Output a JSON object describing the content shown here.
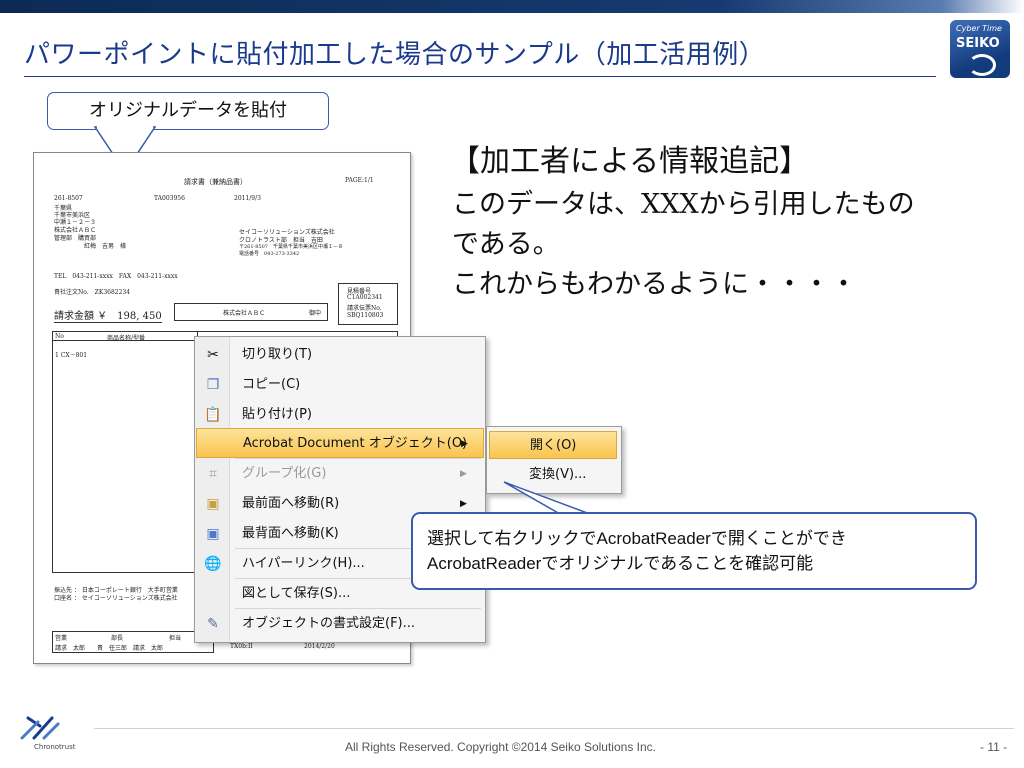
{
  "slide": {
    "title": "パワーポイントに貼付加工した場合のサンプル（加工活用例）",
    "page_number": "- 11 -",
    "copyright": "All Rights Reserved. Copyright ©2014  Seiko Solutions Inc."
  },
  "logo": {
    "line1": "Cyber Time",
    "line2": "SEIKO"
  },
  "brand": {
    "name": "Chronotrust"
  },
  "callout_top": {
    "text": "オリジナルデータを貼付"
  },
  "info": {
    "heading": "【加工者による情報追記】",
    "lines": [
      "このデータは、XXXから引用したもの",
      "である。",
      "これからもわかるように・・・・"
    ]
  },
  "document": {
    "title": "請求書（兼納品書）",
    "page": "PAGE:1/1",
    "number": "TA003956",
    "date": "2011/9/3",
    "postal": "261-8507",
    "addr1": "千葉県",
    "addr2": "千葉市美浜区",
    "addr3": "中瀬１－２－３",
    "customer": "株式会社ＡＢＣ",
    "dept": "管理部　購買部",
    "person": "紅梅　吉男　様",
    "issuer1": "セイコーソリューションズ株式会社",
    "issuer2": "クロノトラスト部　担当　吉田",
    "issuer3": "〒261-8507　千葉県千葉市美浜区中瀬１－８",
    "issuer4": "電話番号　043-273-3342",
    "tel": "TEL　043-211-xxxx　FAX　043-211-xxxx",
    "order": "貴社注文No.　ZK3682234",
    "amount_label": "請求金額 ￥　198, 450",
    "company_box": "株式会社ＡＢＣ",
    "oncho": "御中",
    "estimate_label": "見積番号",
    "estimate_no": "C1A002341",
    "invoice_label": "請求伝票No.",
    "invoice_no": "SBQ110803",
    "col_no": "No",
    "col_item": "商品名称/型番",
    "row1": "1  CX－801",
    "bank1": "振込先 ： 日本コーポレート銀行　大手町営業",
    "bank2": "口座名 ： セイコーソリューションズ株式会社",
    "stamp_h1": "営業",
    "stamp_h2": "部長",
    "stamp_h3": "担当",
    "stamp_v": "請求　太郎　　貴　任三郎　請求　太郎",
    "bottom_left": "TX0b:II",
    "bottom_date": "2014/2/20"
  },
  "context_menu": {
    "items": [
      {
        "label": "切り取り(T)",
        "icon": "scissors-icon"
      },
      {
        "label": "コピー(C)",
        "icon": "copy-icon"
      },
      {
        "label": "貼り付け(P)",
        "icon": "paste-icon"
      },
      {
        "label": "Acrobat Document オブジェクト(O)",
        "icon": "",
        "submenu": true,
        "highlighted": true
      },
      {
        "label": "グループ化(G)",
        "icon": "group-icon",
        "submenu": true,
        "disabled": true
      },
      {
        "label": "最前面へ移動(R)",
        "icon": "bring-front-icon",
        "submenu": true
      },
      {
        "label": "最背面へ移動(K)",
        "icon": "send-back-icon"
      },
      {
        "label": "ハイパーリンク(H)...",
        "icon": "hyperlink-icon"
      },
      {
        "label": "図として保存(S)...",
        "icon": ""
      },
      {
        "label": "オブジェクトの書式設定(F)...",
        "icon": "format-icon"
      }
    ],
    "arrow": "▶"
  },
  "submenu": {
    "items": [
      {
        "label": "開く(O)",
        "highlighted": true
      },
      {
        "label": "変換(V)..."
      }
    ]
  },
  "callout_bottom": {
    "line1": "選択して右クリックでAcrobatReaderで開くことができ",
    "line2": "AcrobatReaderでオリジナルであることを確認可能"
  },
  "colors": {
    "accent": "#1a3a8c",
    "highlight": "#f8c44e",
    "callout_border": "#3a5ab0"
  }
}
